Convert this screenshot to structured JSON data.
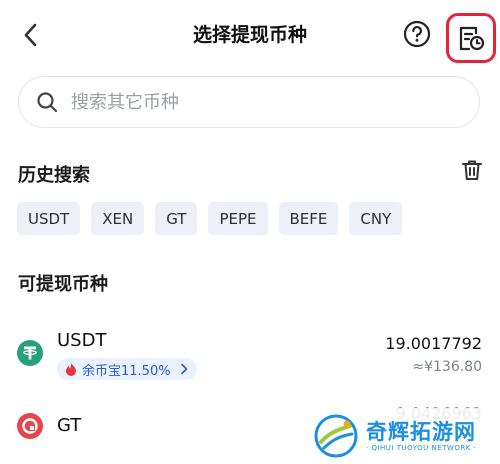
{
  "header": {
    "title": "选择提现币种"
  },
  "search": {
    "placeholder": "搜索其它币种",
    "value": ""
  },
  "history": {
    "title": "历史搜索",
    "chips": [
      "USDT",
      "XEN",
      "GT",
      "PEPE",
      "BEFE",
      "CNY"
    ]
  },
  "available": {
    "title": "可提现币种",
    "coins": [
      {
        "symbol": "USDT",
        "balance": "19.0017792",
        "fiat": "≈¥136.80",
        "yield_label": "余币宝11.50%",
        "icon": "tether-icon",
        "icon_color": "#26a17b"
      },
      {
        "symbol": "GT",
        "balance": "9.0426963",
        "icon": "gatetoken-icon",
        "icon_color": "#e4474b"
      }
    ]
  },
  "watermark": {
    "main": "奇辉拓游网",
    "sub": "· QIHUI TUOYOU NETWORK ·"
  },
  "colors": {
    "accent": "#2a5bd7",
    "highlight_box": "#e5243b",
    "chip_bg": "#edf0f7"
  }
}
